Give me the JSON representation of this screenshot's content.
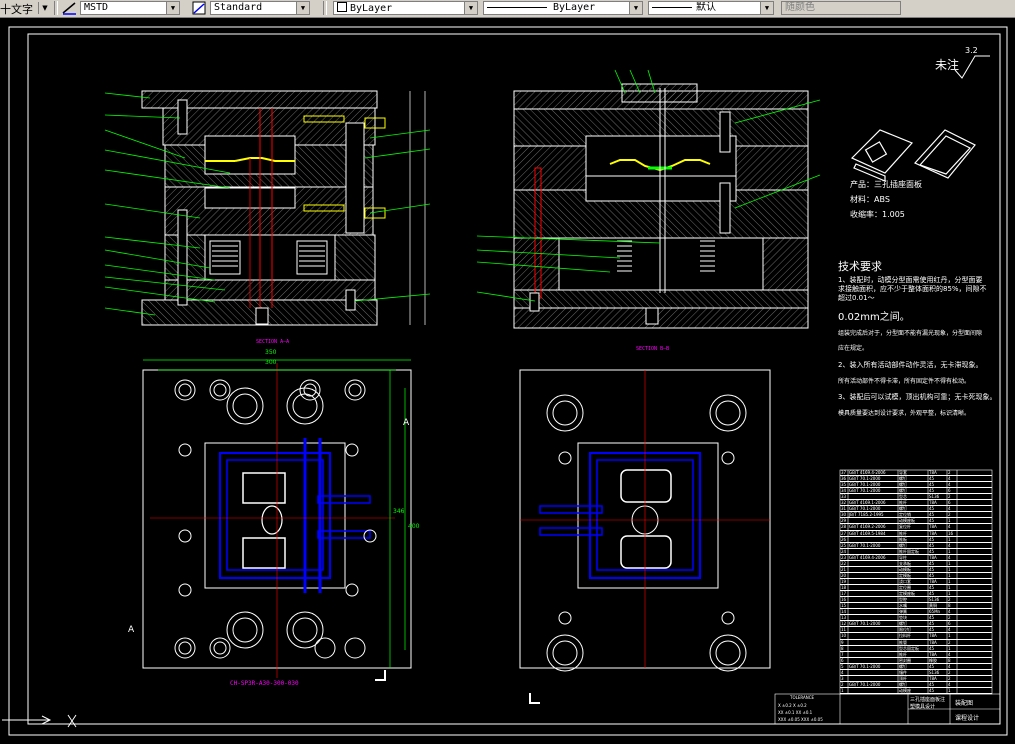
{
  "toolbar": {
    "text_style_label": "十文字",
    "dim_style_value": "MSTD",
    "table_style_value": "Standard",
    "layer_value": "ByLayer",
    "linetype_value": "ByLayer",
    "lineweight_value": "默认",
    "plotstyle_value": "随颜色"
  },
  "drawing": {
    "section_a_label": "SECTION A—A",
    "section_b_label": "SECTION B—B",
    "tech_title": "技术要求",
    "tech_items": [
      "1、装配时，动模分型面需使用红丹，分型面要求接触面积，应不少于整体面积的85%，间隙不超过0.01～",
      "0.02mm之间。",
      "组装完成后对于，分型面不能有漏光现象，分型面间隙",
      "应在规定。",
      "2、装入所有活动部件动作灵活，无卡滞现象。",
      "所有活动部件不得卡滞，所有固定件不得有松动。",
      "3、装配后可以试模，顶出机构可靠；无卡死现象。",
      "模具质量要达到设计要求，外观平整，标识清晰。"
    ],
    "product_name": "产品：三孔插座面板",
    "material": "材料：ABS",
    "shrinkage": "收缩率：1.005",
    "roughness_label": "未注",
    "roughness_value": "3.2",
    "part_number_text": "CH-SP3R-A30-300-030",
    "section_mark_a": "A",
    "dims": {
      "w1": "350",
      "w2": "300",
      "h1": "346",
      "h2": "400"
    }
  },
  "title_block": {
    "main_title": "三孔插座面板注塑模具设计",
    "drawing_type": "装配图",
    "school": "课程设计",
    "tolerance": "TOLERANCE",
    "tolerance_rows": [
      "X ±0.2   X ±0.2",
      "XX ±0.1  XX ±0.1",
      "XXX ±0.05  XXX ±0.05"
    ]
  },
  "bom": {
    "rows": [
      [
        "37",
        "GB/T 4169.4-2006",
        "导套",
        "T8A",
        "2",
        ""
      ],
      [
        "36",
        "GB/T 70.1-2000",
        "螺钉",
        "45",
        "4",
        ""
      ],
      [
        "35",
        "GB/T 70.1-2000",
        "螺钉",
        "45",
        "4",
        ""
      ],
      [
        "34",
        "GB/T 70.1-2000",
        "螺钉",
        "45",
        "6",
        ""
      ],
      [
        "33",
        "",
        "型芯",
        "S136",
        "2",
        ""
      ],
      [
        "32",
        "GB/T 4169.1-2006",
        "推杆",
        "T8A",
        "6",
        ""
      ],
      [
        "31",
        "GB/T 70.1-2000",
        "螺钉",
        "45",
        "4",
        ""
      ],
      [
        "30",
        "JB/T 7185.2-1995",
        "定位销",
        "45",
        "2",
        ""
      ],
      [
        "29",
        "",
        "动模座板",
        "45",
        "1",
        ""
      ],
      [
        "28",
        "GB/T 4169.2-2006",
        "复位杆",
        "T8A",
        "4",
        ""
      ],
      [
        "27",
        "GB/T 4169.5-1984",
        "推杆",
        "T8A",
        "16",
        ""
      ],
      [
        "26",
        "",
        "推板",
        "45",
        "1",
        ""
      ],
      [
        "25",
        "GB/T 70.1-2000",
        "螺钉",
        "45",
        "4",
        ""
      ],
      [
        "24",
        "",
        "推杆固定板",
        "45",
        "1",
        ""
      ],
      [
        "23",
        "GB/T 4169.4-2006",
        "导柱",
        "T8A",
        "4",
        ""
      ],
      [
        "22",
        "",
        "支承板",
        "45",
        "1",
        ""
      ],
      [
        "21",
        "",
        "动模板",
        "45",
        "1",
        ""
      ],
      [
        "20",
        "",
        "定模板",
        "45",
        "1",
        ""
      ],
      [
        "19",
        "",
        "浇口套",
        "T8A",
        "1",
        ""
      ],
      [
        "18",
        "",
        "定位圈",
        "45",
        "1",
        ""
      ],
      [
        "17",
        "",
        "定模座板",
        "45",
        "1",
        ""
      ],
      [
        "16",
        "",
        "型腔",
        "S136",
        "2",
        ""
      ],
      [
        "15",
        "",
        "水嘴",
        "黄铜",
        "8",
        ""
      ],
      [
        "14",
        "",
        "弹簧",
        "65Mn",
        "4",
        ""
      ],
      [
        "13",
        "",
        "垫块",
        "45",
        "2",
        ""
      ],
      [
        "12",
        "GB/T 70.1-2000",
        "螺钉",
        "45",
        "6",
        ""
      ],
      [
        "11",
        "",
        "限位钉",
        "45",
        "4",
        ""
      ],
      [
        "10",
        "",
        "拉料杆",
        "T8A",
        "1",
        ""
      ],
      [
        "9",
        "",
        "推管",
        "T8A",
        "2",
        ""
      ],
      [
        "8",
        "",
        "型芯固定板",
        "45",
        "1",
        ""
      ],
      [
        "7",
        "",
        "推杆",
        "T8A",
        "4",
        ""
      ],
      [
        "6",
        "",
        "密封圈",
        "橡胶",
        "8",
        ""
      ],
      [
        "5",
        "GB/T 70.1-2000",
        "螺钉",
        "45",
        "4",
        ""
      ],
      [
        "4",
        "",
        "镶件",
        "S136",
        "2",
        ""
      ],
      [
        "3",
        "",
        "顶杆",
        "T8A",
        "2",
        ""
      ],
      [
        "2",
        "GB/T 70.1-2000",
        "螺钉",
        "45",
        "4",
        ""
      ],
      [
        "1",
        "",
        "动模座",
        "45",
        "1",
        ""
      ]
    ]
  }
}
